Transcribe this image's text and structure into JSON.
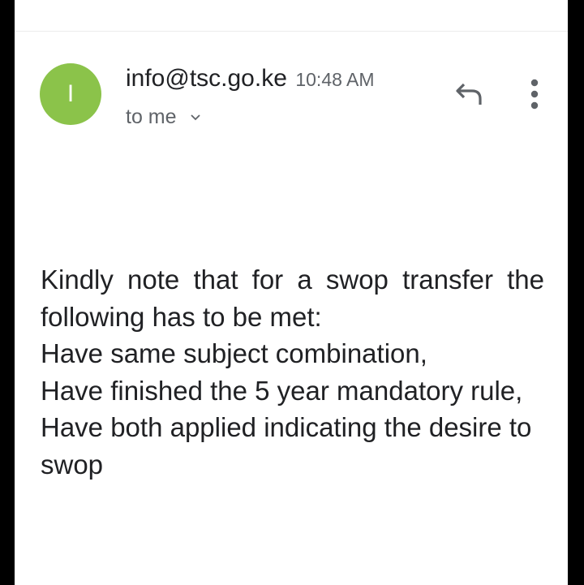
{
  "header": {
    "avatar_letter": "I",
    "avatar_color": "#8bc34a",
    "sender": "info@tsc.go.ke",
    "time": "10:48 AM",
    "recipient": "to me",
    "icons": [
      "reply-icon",
      "more-vert-icon",
      "chevron-down-icon"
    ]
  },
  "message": {
    "lines": [
      "Kindly note that for a swop transfer the following has to be met:",
      "Have same subject combination,",
      "Have finished the 5 year mandatory rule,",
      "Have both applied indicating the desire to swop"
    ]
  }
}
